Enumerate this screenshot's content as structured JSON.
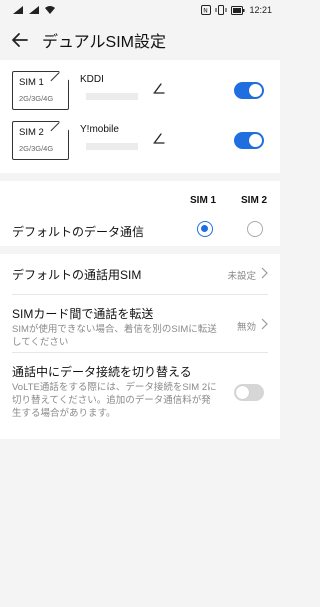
{
  "status_bar": {
    "battery_level": "■",
    "time": "12:21"
  },
  "header": {
    "title": "デュアルSIM設定"
  },
  "sims": [
    {
      "chip_name": "SIM 1",
      "network": "2G/3G/4G",
      "carrier": "KDDI",
      "enabled": true
    },
    {
      "chip_name": "SIM 2",
      "network": "2G/3G/4G",
      "carrier": "Y!mobile",
      "enabled": true
    }
  ],
  "default_data": {
    "col_sim1": "SIM 1",
    "col_sim2": "SIM 2",
    "label": "デフォルトのデータ通信",
    "selected": "SIM 1"
  },
  "settings": {
    "default_call": {
      "label": "デフォルトの通話用SIM",
      "value": "未設定"
    },
    "call_forward": {
      "label": "SIMカード間で通話を転送",
      "desc": "SIMが使用できない場合、着信を別のSIMに転送してください",
      "value": "無効"
    },
    "data_switch": {
      "label": "通話中にデータ接続を切り替える",
      "desc": "VoLTE通話をする際には、データ接続をSIM 2に切り替えてください。追加のデータ通信料が発生する場合があります。",
      "enabled": false
    }
  },
  "colors": {
    "accent": "#1f6fe0",
    "background": "#f4f4f4",
    "toggle_off": "#d6d6d6"
  }
}
